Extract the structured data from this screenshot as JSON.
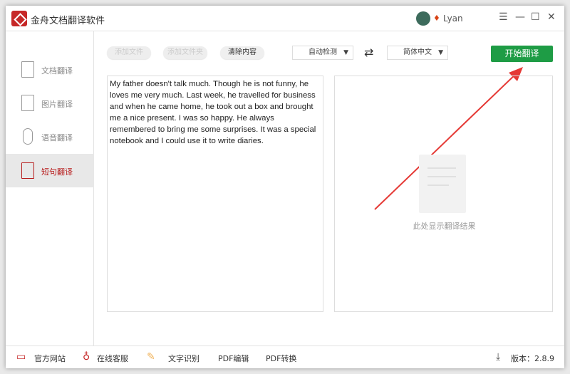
{
  "app": {
    "title": "金舟文档翻译软件",
    "user": "Lyan"
  },
  "window_controls": {
    "menu": "☰",
    "minimize": "—",
    "maximize": "☐",
    "close": "✕"
  },
  "sidebar": {
    "items": [
      {
        "label": "文档翻译"
      },
      {
        "label": "图片翻译"
      },
      {
        "label": "语音翻译"
      },
      {
        "label": "短句翻译",
        "active": true
      }
    ]
  },
  "toolbar": {
    "add_file": "添加文件",
    "add_folder": "添加文件夹",
    "clear": "清除内容",
    "source_lang": "自动检测",
    "target_lang": "简体中文",
    "swap": "⇄",
    "translate": "开始翻译"
  },
  "source_text": "My father doesn't talk much. Though he is not funny, he loves me very much. Last week, he travelled for business and when he came home, he took out a box and brought me a nice present. I was so happy. He always remembered to bring me some surprises. It was a special notebook and I could use it to write diaries.",
  "result_placeholder": "此处显示翻译结果",
  "footer": {
    "website": "官方网站",
    "support": "在线客服",
    "ocr": "文字识别",
    "pdf_edit": "PDF编辑",
    "pdf_convert": "PDF转换",
    "version": "版本：2.8.9"
  },
  "colors": {
    "accent": "#b71c1c",
    "green": "#1e9c45"
  }
}
